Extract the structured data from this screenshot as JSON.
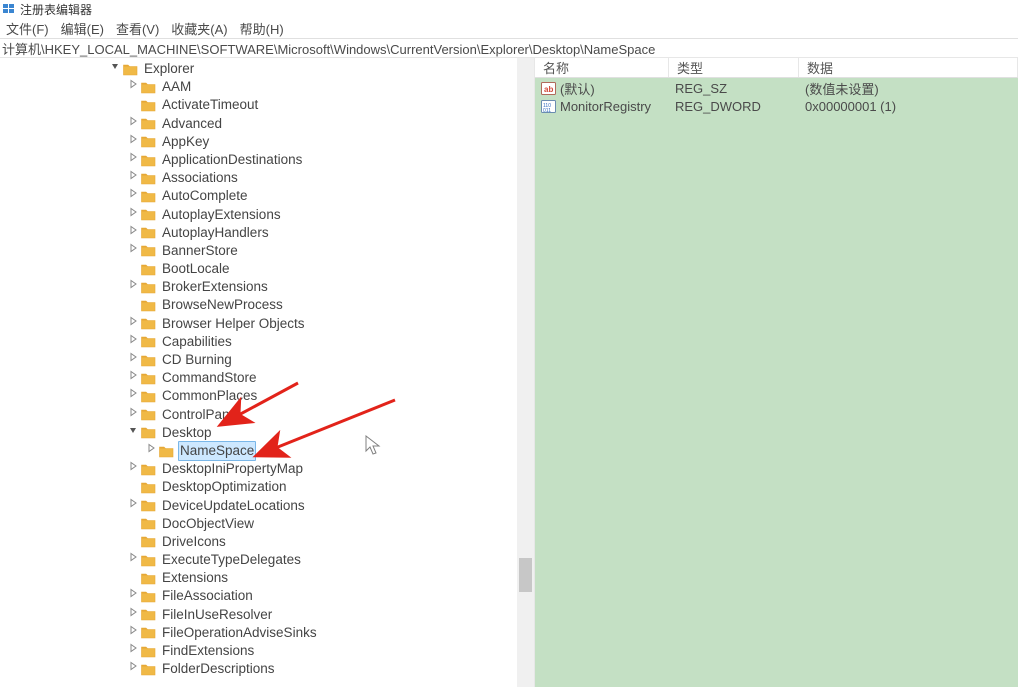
{
  "app": {
    "title": "注册表编辑器",
    "address": "计算机\\HKEY_LOCAL_MACHINE\\SOFTWARE\\Microsoft\\Windows\\CurrentVersion\\Explorer\\Desktop\\NameSpace"
  },
  "menu": {
    "file": "文件(F)",
    "edit": "编辑(E)",
    "view": "查看(V)",
    "fav": "收藏夹(A)",
    "help": "帮助(H)"
  },
  "tree": {
    "root_mark": "❯",
    "items": [
      {
        "depth": 6,
        "toggle": "down",
        "label": "Explorer"
      },
      {
        "depth": 7,
        "toggle": "right",
        "label": "AAM"
      },
      {
        "depth": 7,
        "toggle": "none",
        "label": "ActivateTimeout"
      },
      {
        "depth": 7,
        "toggle": "right",
        "label": "Advanced"
      },
      {
        "depth": 7,
        "toggle": "right",
        "label": "AppKey"
      },
      {
        "depth": 7,
        "toggle": "right",
        "label": "ApplicationDestinations"
      },
      {
        "depth": 7,
        "toggle": "right",
        "label": "Associations"
      },
      {
        "depth": 7,
        "toggle": "right",
        "label": "AutoComplete"
      },
      {
        "depth": 7,
        "toggle": "right",
        "label": "AutoplayExtensions"
      },
      {
        "depth": 7,
        "toggle": "right",
        "label": "AutoplayHandlers"
      },
      {
        "depth": 7,
        "toggle": "right",
        "label": "BannerStore"
      },
      {
        "depth": 7,
        "toggle": "none",
        "label": "BootLocale"
      },
      {
        "depth": 7,
        "toggle": "right",
        "label": "BrokerExtensions"
      },
      {
        "depth": 7,
        "toggle": "none",
        "label": "BrowseNewProcess"
      },
      {
        "depth": 7,
        "toggle": "right",
        "label": "Browser Helper Objects"
      },
      {
        "depth": 7,
        "toggle": "right",
        "label": "Capabilities"
      },
      {
        "depth": 7,
        "toggle": "right",
        "label": "CD Burning"
      },
      {
        "depth": 7,
        "toggle": "right",
        "label": "CommandStore"
      },
      {
        "depth": 7,
        "toggle": "right",
        "label": "CommonPlaces"
      },
      {
        "depth": 7,
        "toggle": "right",
        "label": "ControlPanel"
      },
      {
        "depth": 7,
        "toggle": "down",
        "label": "Desktop"
      },
      {
        "depth": 8,
        "toggle": "right",
        "label": "NameSpace",
        "selected": true
      },
      {
        "depth": 7,
        "toggle": "right",
        "label": "DesktopIniPropertyMap"
      },
      {
        "depth": 7,
        "toggle": "none",
        "label": "DesktopOptimization"
      },
      {
        "depth": 7,
        "toggle": "right",
        "label": "DeviceUpdateLocations"
      },
      {
        "depth": 7,
        "toggle": "none",
        "label": "DocObjectView"
      },
      {
        "depth": 7,
        "toggle": "none",
        "label": "DriveIcons"
      },
      {
        "depth": 7,
        "toggle": "right",
        "label": "ExecuteTypeDelegates"
      },
      {
        "depth": 7,
        "toggle": "none",
        "label": "Extensions"
      },
      {
        "depth": 7,
        "toggle": "right",
        "label": "FileAssociation"
      },
      {
        "depth": 7,
        "toggle": "right",
        "label": "FileInUseResolver"
      },
      {
        "depth": 7,
        "toggle": "right",
        "label": "FileOperationAdviseSinks"
      },
      {
        "depth": 7,
        "toggle": "right",
        "label": "FindExtensions"
      },
      {
        "depth": 7,
        "toggle": "right",
        "label": "FolderDescriptions"
      }
    ]
  },
  "values": {
    "headers": {
      "name": "名称",
      "type": "类型",
      "data": "数据"
    },
    "rows": [
      {
        "icon": "string",
        "name": "(默认)",
        "type": "REG_SZ",
        "data": "(数值未设置)"
      },
      {
        "icon": "binary",
        "name": "MonitorRegistry",
        "type": "REG_DWORD",
        "data": "0x00000001 (1)"
      }
    ]
  },
  "icons": {
    "folder_color": "#f0b946",
    "folder_color2": "#e6a836",
    "ab_red": "#d14836",
    "bin_blue": "#2d6abf"
  }
}
